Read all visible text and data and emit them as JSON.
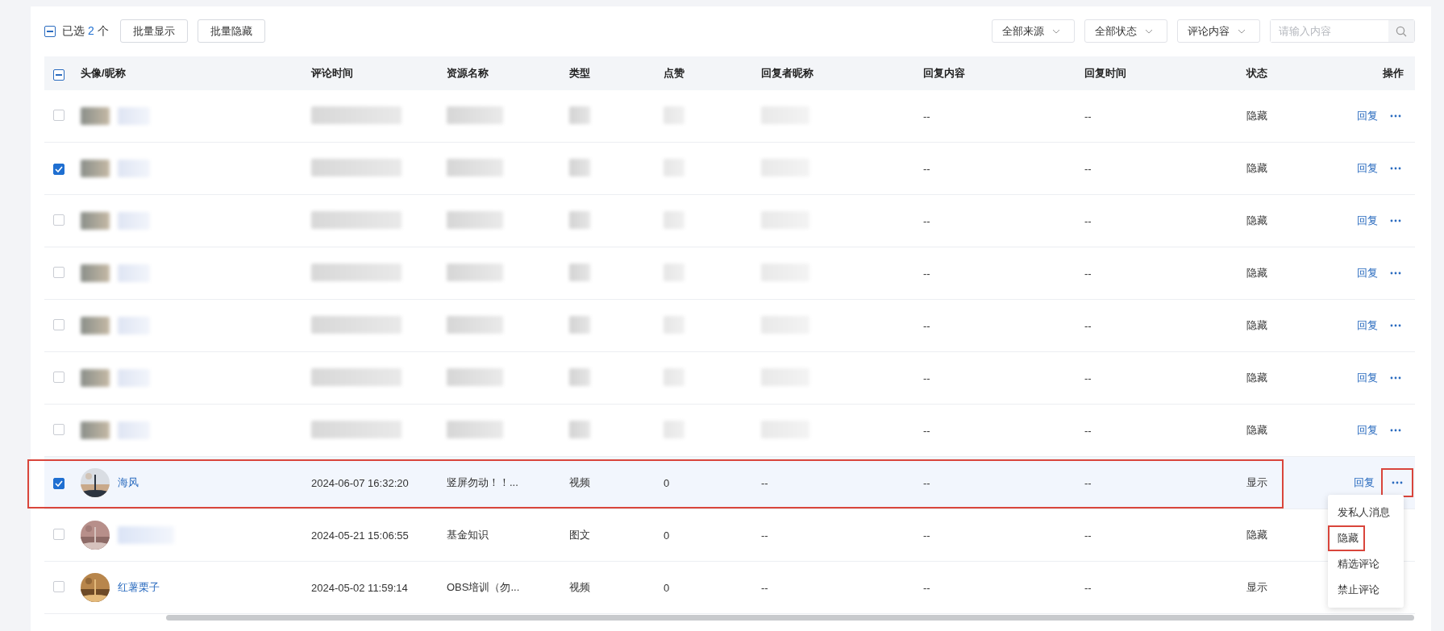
{
  "toolbar": {
    "select_all_indeterminate": true,
    "selected_prefix": "已选",
    "selected_count": "2",
    "selected_suffix": "个",
    "buttons": [
      "批量显示",
      "批量隐藏"
    ],
    "filters": [
      {
        "label": "全部来源"
      },
      {
        "label": "全部状态"
      },
      {
        "label": "评论内容"
      }
    ],
    "search": {
      "placeholder": "请输入内容"
    }
  },
  "table": {
    "header_indeterminate": true,
    "columns": [
      "头像/昵称",
      "评论时间",
      "资源名称",
      "类型",
      "点赞",
      "回复者昵称",
      "回复内容",
      "回复时间",
      "状态",
      "操作"
    ],
    "rows": [
      {
        "kind": "redacted",
        "checked": false,
        "selected": false,
        "reply_content": "--",
        "reply_time": "--",
        "status": "隐藏",
        "action": "回复",
        "more_framed": false
      },
      {
        "kind": "redacted",
        "checked": true,
        "selected": false,
        "reply_content": "--",
        "reply_time": "--",
        "status": "隐藏",
        "action": "回复",
        "more_framed": false
      },
      {
        "kind": "redacted",
        "checked": false,
        "selected": false,
        "reply_content": "--",
        "reply_time": "--",
        "status": "隐藏",
        "action": "回复",
        "more_framed": false
      },
      {
        "kind": "redacted",
        "checked": false,
        "selected": false,
        "reply_content": "--",
        "reply_time": "--",
        "status": "隐藏",
        "action": "回复",
        "more_framed": false
      },
      {
        "kind": "redacted",
        "checked": false,
        "selected": false,
        "reply_content": "--",
        "reply_time": "--",
        "status": "隐藏",
        "action": "回复",
        "more_framed": false
      },
      {
        "kind": "redacted",
        "checked": false,
        "selected": false,
        "reply_content": "--",
        "reply_time": "--",
        "status": "隐藏",
        "action": "回复",
        "more_framed": false
      },
      {
        "kind": "redacted",
        "checked": false,
        "selected": false,
        "reply_content": "--",
        "reply_time": "--",
        "status": "隐藏",
        "action": "回复",
        "more_framed": false
      },
      {
        "kind": "plain",
        "checked": true,
        "selected": true,
        "framed": true,
        "nickname": "海风",
        "comment_time": "2024-06-07 16:32:20",
        "resource": "竖屏勿动！！...",
        "type": "视频",
        "likes": "0",
        "reply_nickname": "--",
        "reply_content": "--",
        "reply_time": "--",
        "status": "显示",
        "action": "回复",
        "more_framed": true
      },
      {
        "kind": "plain",
        "checked": false,
        "selected": false,
        "comment_time": "2024-05-21 15:06:55",
        "resource": "基金知识",
        "type": "图文",
        "likes": "0",
        "reply_nickname": "--",
        "reply_content": "--",
        "reply_time": "--",
        "status": "隐藏"
      },
      {
        "kind": "plain",
        "checked": false,
        "selected": false,
        "nickname": "红薯栗子",
        "comment_time": "2024-05-02 11:59:14",
        "resource": "OBS培训（勿...",
        "type": "视频",
        "likes": "0",
        "reply_nickname": "--",
        "reply_content": "--",
        "reply_time": "--",
        "status": "显示"
      }
    ]
  },
  "menu": {
    "items": [
      {
        "label": "发私人消息",
        "framed": false
      },
      {
        "label": "隐藏",
        "framed": true
      },
      {
        "label": "精选评论",
        "framed": false
      },
      {
        "label": "禁止评论",
        "framed": false
      }
    ]
  }
}
